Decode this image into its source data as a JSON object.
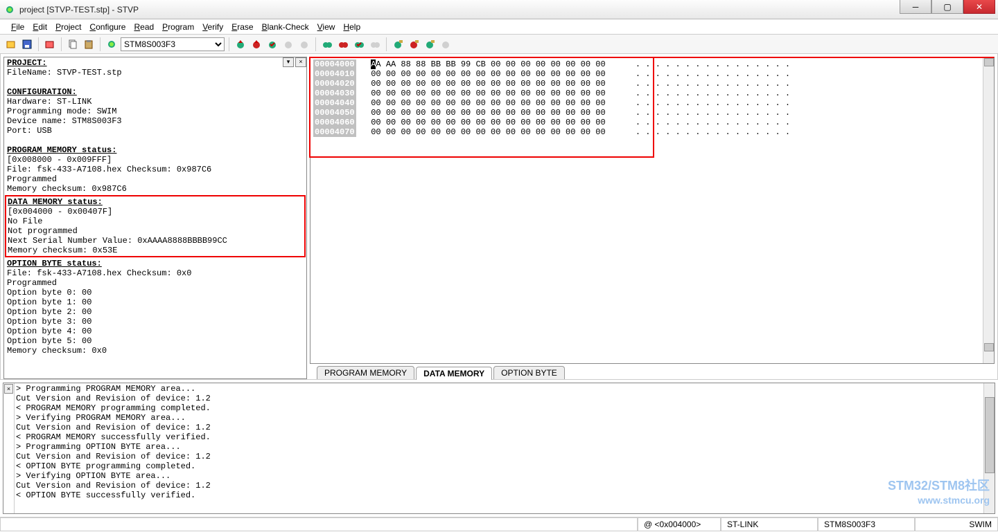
{
  "title": "project [STVP-TEST.stp] - STVP",
  "menu": [
    "File",
    "Edit",
    "Project",
    "Configure",
    "Read",
    "Program",
    "Verify",
    "Erase",
    "Blank-Check",
    "View",
    "Help"
  ],
  "device_selected": "STM8S003F3",
  "left": {
    "project_h": "PROJECT:",
    "filename": "FileName: STVP-TEST.stp",
    "config_h": "CONFIGURATION:",
    "hardware": "Hardware: ST-LINK",
    "progmode": "Programming mode: SWIM",
    "devname": "Device name: STM8S003F3",
    "port": "Port: USB",
    "progmem_h": "PROGRAM MEMORY status:",
    "progmem_range": "[0x008000 - 0x009FFF]",
    "progmem_file": "File: fsk-433-A7108.hex Checksum: 0x987C6",
    "progmem_prog": "Programmed",
    "progmem_chk": "Memory checksum: 0x987C6",
    "datamem_h": "DATA MEMORY status:",
    "datamem_range": "[0x004000 - 0x00407F]",
    "datamem_file": "No File",
    "datamem_prog": "Not programmed",
    "datamem_serial": "Next Serial Number Value: 0xAAAA8888BBBB99CC",
    "datamem_chk": "Memory checksum: 0x53E",
    "optbyte_h": "OPTION BYTE status:",
    "optbyte_file": "File: fsk-433-A7108.hex Checksum: 0x0",
    "optbyte_prog": "Programmed",
    "ob0": "Option byte 0: 00",
    "ob1": "Option byte 1: 00",
    "ob2": "Option byte 2: 00",
    "ob3": "Option byte 3: 00",
    "ob4": "Option byte 4: 00",
    "ob5": "Option byte 5: 00",
    "optbyte_chk": "Memory checksum: 0x0"
  },
  "hex": {
    "rows": [
      {
        "addr": "00004000",
        "first": "AA",
        "rest": " AA 88 88 BB BB 99 CB 00 00 00 00 00 00 00 00",
        "ascii": ". . . . . . . . . . . . . . . ."
      },
      {
        "addr": "00004010",
        "first": "00",
        "rest": " 00 00 00 00 00 00 00 00 00 00 00 00 00 00 00",
        "ascii": ". . . . . . . . . . . . . . . ."
      },
      {
        "addr": "00004020",
        "first": "00",
        "rest": " 00 00 00 00 00 00 00 00 00 00 00 00 00 00 00",
        "ascii": ". . . . . . . . . . . . . . . ."
      },
      {
        "addr": "00004030",
        "first": "00",
        "rest": " 00 00 00 00 00 00 00 00 00 00 00 00 00 00 00",
        "ascii": ". . . . . . . . . . . . . . . ."
      },
      {
        "addr": "00004040",
        "first": "00",
        "rest": " 00 00 00 00 00 00 00 00 00 00 00 00 00 00 00",
        "ascii": ". . . . . . . . . . . . . . . ."
      },
      {
        "addr": "00004050",
        "first": "00",
        "rest": " 00 00 00 00 00 00 00 00 00 00 00 00 00 00 00",
        "ascii": ". . . . . . . . . . . . . . . ."
      },
      {
        "addr": "00004060",
        "first": "00",
        "rest": " 00 00 00 00 00 00 00 00 00 00 00 00 00 00 00",
        "ascii": ". . . . . . . . . . . . . . . ."
      },
      {
        "addr": "00004070",
        "first": "00",
        "rest": " 00 00 00 00 00 00 00 00 00 00 00 00 00 00 00",
        "ascii": ". . . . . . . . . . . . . . . ."
      }
    ]
  },
  "tabs": [
    "PROGRAM MEMORY",
    "DATA MEMORY",
    "OPTION BYTE"
  ],
  "active_tab": 1,
  "log": [
    "> Programming  PROGRAM MEMORY area...",
    "Cut Version and Revision of device: 1.2",
    "< PROGRAM MEMORY programming completed.",
    "> Verifying PROGRAM MEMORY area...",
    "Cut Version and Revision of device: 1.2",
    "< PROGRAM MEMORY successfully verified.",
    "> Programming  OPTION BYTE area...",
    "Cut Version and Revision of device: 1.2",
    "< OPTION BYTE programming completed.",
    "> Verifying OPTION BYTE area...",
    "Cut Version and Revision of device: 1.2",
    "< OPTION BYTE successfully verified."
  ],
  "status": {
    "addr": "@ <0x004000>",
    "hw": "ST-LINK",
    "dev": "STM8S003F3",
    "mode": "SWIM"
  },
  "watermark1": "STM32/STM8社区",
  "watermark2": "www.stmcu.org"
}
